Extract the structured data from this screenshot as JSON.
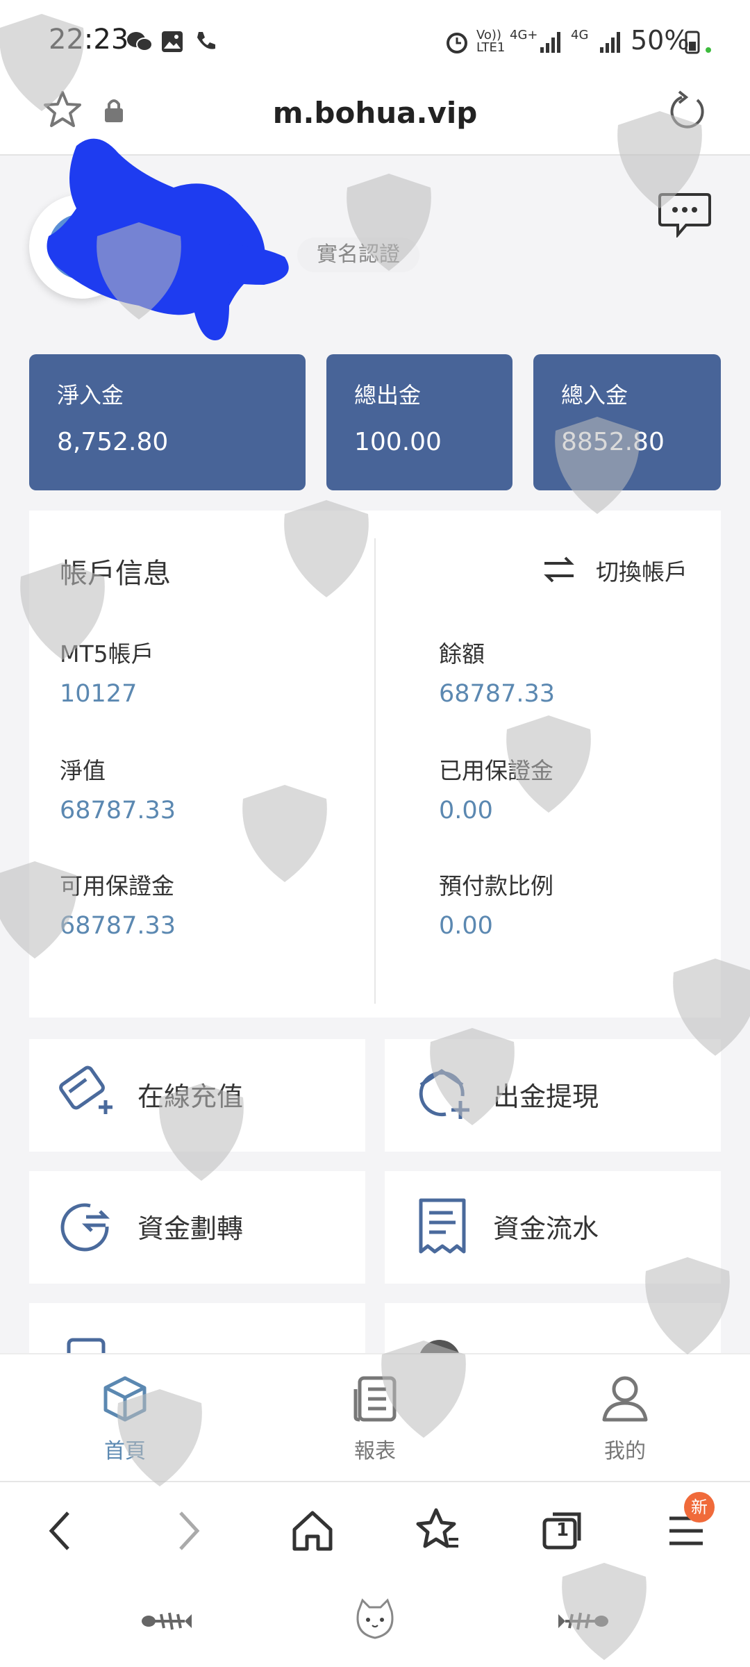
{
  "status_bar": {
    "time": "22:23",
    "net1": "Vo)) LTE1",
    "net2": "4G+",
    "net3": "4G",
    "battery": "50%"
  },
  "browser": {
    "url": "m.bohua.vip"
  },
  "profile": {
    "verify_label": "實名認證"
  },
  "summary_cards": [
    {
      "label": "淨入金",
      "value": "8,752.80"
    },
    {
      "label": "總出金",
      "value": "100.00"
    },
    {
      "label": "總入金",
      "value": "8852.80"
    }
  ],
  "account": {
    "title": "帳戶信息",
    "switch_label": "切換帳戶",
    "fields": [
      {
        "label": "MT5帳戶",
        "value": "10127"
      },
      {
        "label": "餘額",
        "value": "68787.33"
      },
      {
        "label": "淨值",
        "value": "68787.33"
      },
      {
        "label": "已用保證金",
        "value": "0.00"
      },
      {
        "label": "可用保證金",
        "value": "68787.33"
      },
      {
        "label": "預付款比例",
        "value": "0.00"
      }
    ]
  },
  "actions": [
    {
      "label": "在線充值",
      "icon": "card-add-icon"
    },
    {
      "label": "出金提現",
      "icon": "withdraw-icon"
    },
    {
      "label": "資金劃轉",
      "icon": "transfer-icon"
    },
    {
      "label": "資金流水",
      "icon": "receipt-icon"
    }
  ],
  "app_nav": [
    {
      "label": "首頁",
      "icon": "cube-icon",
      "active": true
    },
    {
      "label": "報表",
      "icon": "report-icon",
      "active": false
    },
    {
      "label": "我的",
      "icon": "user-icon",
      "active": false
    }
  ],
  "browser_bar": {
    "tab_count": "1",
    "badge": "新"
  },
  "colors": {
    "card_bg": "#486498",
    "value_blue": "#5b88b1",
    "icon_blue": "#4a6a9c",
    "badge": "#f06a3a"
  }
}
